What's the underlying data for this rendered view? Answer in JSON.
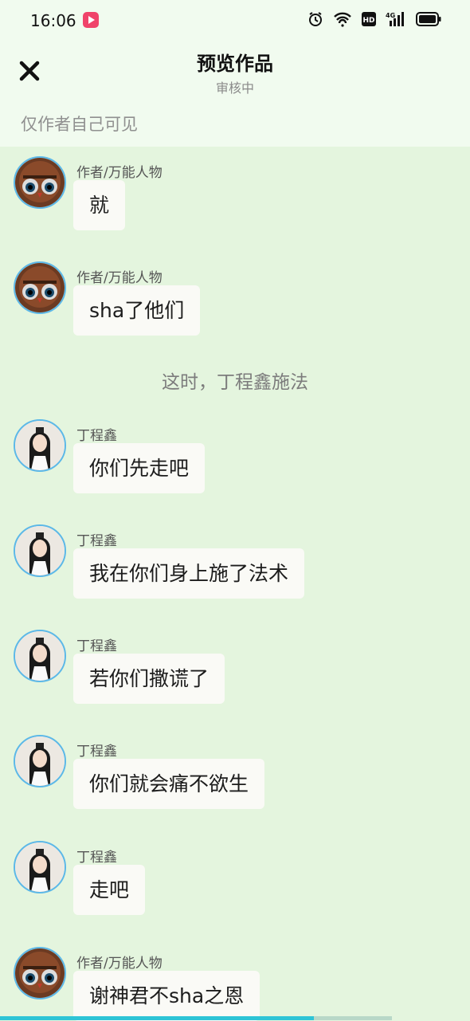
{
  "status_bar": {
    "time": "16:06"
  },
  "header": {
    "title": "预览作品",
    "subtitle": "审核中",
    "visibility_note": "仅作者自己可见"
  },
  "colors": {
    "header_bg": "#f1fbef",
    "chat_bg": "#e4f5de",
    "bubble_bg": "#fafaf6",
    "avatar_ring": "#5cb8e8",
    "progress": "#2ec4d6"
  },
  "messages": [
    {
      "type": "bubble",
      "sender": "作者/万能人物",
      "text": "就",
      "avatar": "owl-avatar"
    },
    {
      "type": "bubble",
      "sender": "作者/万能人物",
      "text": "sha了他们",
      "avatar": "owl-avatar"
    },
    {
      "type": "narration",
      "text": "这时，丁程鑫施法"
    },
    {
      "type": "bubble",
      "sender": "丁程鑫",
      "text": "你们先走吧",
      "avatar": "person-avatar"
    },
    {
      "type": "bubble",
      "sender": "丁程鑫",
      "text": "我在你们身上施了法术",
      "avatar": "person-avatar"
    },
    {
      "type": "bubble",
      "sender": "丁程鑫",
      "text": "若你们撒谎了",
      "avatar": "person-avatar"
    },
    {
      "type": "bubble",
      "sender": "丁程鑫",
      "text": "你们就会痛不欲生",
      "avatar": "person-avatar"
    },
    {
      "type": "bubble",
      "sender": "丁程鑫",
      "text": "走吧",
      "avatar": "person-avatar"
    },
    {
      "type": "bubble",
      "sender": "作者/万能人物",
      "text": "谢神君不sha之恩",
      "avatar": "owl-avatar"
    }
  ],
  "progress": {
    "fraction": 0.8
  }
}
